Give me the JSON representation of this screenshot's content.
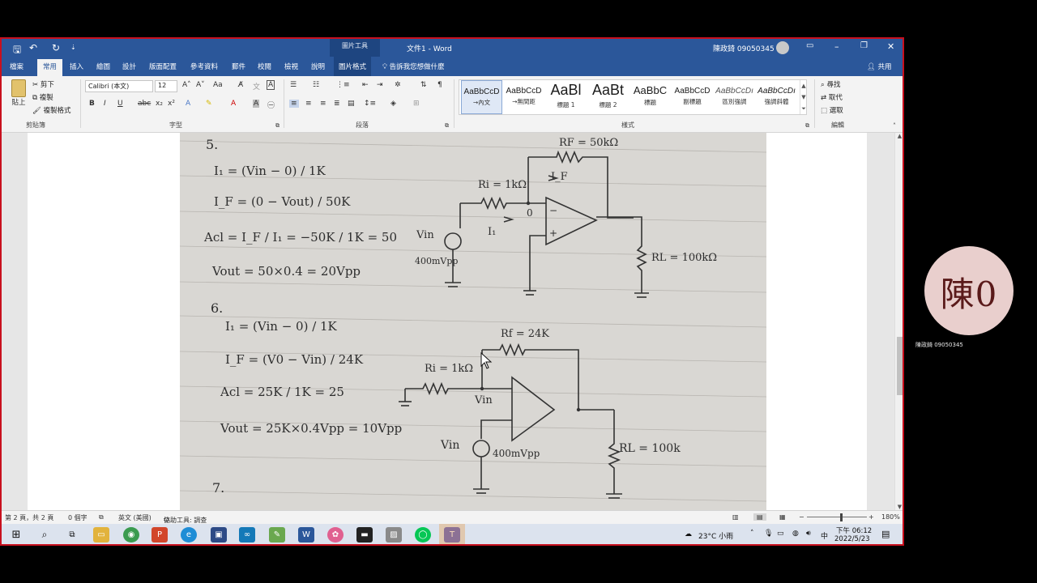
{
  "titlebar": {
    "picture_tools": "圖片工具",
    "document_title": "文件1 - Word",
    "user": "陳政錡 09050345"
  },
  "tabs": [
    "檔案",
    "常用",
    "插入",
    "繪圖",
    "設計",
    "版面配置",
    "參考資料",
    "郵件",
    "校閱",
    "檢視",
    "說明",
    "圖片格式"
  ],
  "tell_me": "告訴我您想做什麼",
  "share": "共用",
  "ribbon": {
    "clipboard": {
      "paste": "貼上",
      "cut": "剪下",
      "copy": "複製",
      "format_painter": "複製格式",
      "label": "剪貼簿"
    },
    "font": {
      "name": "Calibri (本文)",
      "size": "12",
      "label": "字型"
    },
    "paragraph": {
      "label": "段落"
    },
    "styles": {
      "items": [
        {
          "preview": "AaBbCcD",
          "name": "→內文"
        },
        {
          "preview": "AaBbCcD",
          "name": "→無間距"
        },
        {
          "preview": "AaBl",
          "name": "標題 1"
        },
        {
          "preview": "AaBt",
          "name": "標題 2"
        },
        {
          "preview": "AaBbC",
          "name": "標題"
        },
        {
          "preview": "AaBbCcD",
          "name": "副標題"
        },
        {
          "preview": "AaBbCcDı",
          "name": "區別強調"
        },
        {
          "preview": "AaBbCcDı",
          "name": "強調斜體"
        }
      ],
      "label": "樣式"
    },
    "editing": {
      "find": "尋找",
      "replace": "取代",
      "select": "選取",
      "label": "編輯"
    }
  },
  "statusbar": {
    "page": "第 2 頁，共 2 頁",
    "words": "0 個字",
    "language": "英文 (美國)",
    "accessibility": "協助工具: 調查",
    "zoom": "180%"
  },
  "taskbar": {
    "weather": "23°C 小雨",
    "ime": "中",
    "time": "下午 06:12",
    "date": "2022/5/23"
  },
  "participant": {
    "initials": "陳0",
    "name": "陳政錡 09050345"
  },
  "notes": {
    "p5": {
      "num": "5.",
      "eq1": "I₁ = (Vin − 0) / 1K",
      "eq2": "I_F = (0 − Vout) / 50K",
      "acl": "Acl = I_F / I₁ = −50K / 1K = 50",
      "vout": "Vout = 50×0.4 = 20Vpp",
      "rf": "RF = 50kΩ",
      "ri": "Ri = 1kΩ",
      "iF": "I_F",
      "i1": "I₁",
      "vin": "Vin",
      "vin_amp": "400mVpp",
      "rl": "RL = 100kΩ",
      "node": "0"
    },
    "p6": {
      "num": "6.",
      "eq1": "I₁ = (Vin − 0) / 1K",
      "eq2": "I_F = (V0 − Vin) / 24K",
      "acl": "Acl = 25K / 1K = 25",
      "vout": "Vout = 25K×0.4Vpp = 10Vpp",
      "rf": "Rf = 24K",
      "ri": "Ri = 1kΩ",
      "vin_node": "Vin",
      "vin": "Vin",
      "vin_amp": "400mVpp",
      "rl": "RL = 100k"
    },
    "p7": {
      "num": "7."
    }
  }
}
